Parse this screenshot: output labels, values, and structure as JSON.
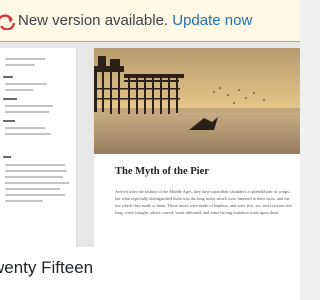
{
  "notice": {
    "message": "New version available.",
    "link_label": "Update now"
  },
  "theme": {
    "name": "wenty Fifteen",
    "post_title": "The Myth of the Pier",
    "post_excerpt": "Arrived after the fashion of the Middle Ages, they have upon their shoulders a splendid pair of wings; but what especially distinguished them was the long noses which were fastened to their faces, and the use which they made of them. These noses were made of bamboo, and were five, six, and even ten feet long, some straight, others curved, some ribboned, and some having imitation warts upon them."
  },
  "colors": {
    "notice_bg": "#fff8e5",
    "link": "#2271b1",
    "warning": "#d63638"
  },
  "icons": {
    "update": "update-icon"
  }
}
